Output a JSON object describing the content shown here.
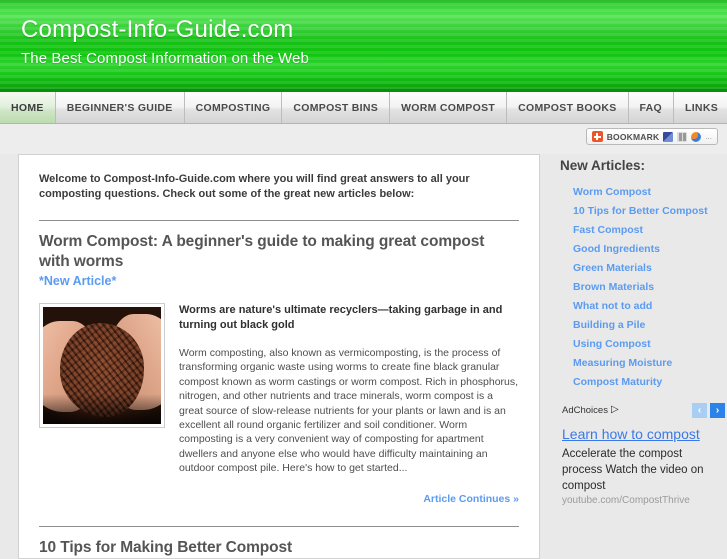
{
  "header": {
    "site_title": "Compost-Info-Guide.com",
    "tagline": "The Best Compost Information on the Web"
  },
  "nav": {
    "items": [
      {
        "label": "HOME",
        "active": true
      },
      {
        "label": "BEGINNER'S GUIDE",
        "active": false
      },
      {
        "label": "COMPOSTING",
        "active": false
      },
      {
        "label": "COMPOST BINS",
        "active": false
      },
      {
        "label": "WORM COMPOST",
        "active": false
      },
      {
        "label": "COMPOST BOOKS",
        "active": false
      },
      {
        "label": "FAQ",
        "active": false
      },
      {
        "label": "LINKS",
        "active": false
      }
    ]
  },
  "bookmark": {
    "label": "BOOKMARK",
    "plus_icon": "plus-icon",
    "icons": [
      "share-square-icon",
      "facebook-icon",
      "share-globe-icon"
    ],
    "more": "..."
  },
  "main": {
    "welcome": "Welcome to Compost-Info-Guide.com where you will find great answers to all your composting questions. Check out some of the great new articles below:",
    "articles": [
      {
        "title": "Worm Compost: A beginner's guide to making great compost with worms",
        "new_flag": "*New Article*",
        "thumb_alt": "hands-holding-worms-image",
        "subhead": "Worms are nature's ultimate recyclers—taking garbage in and turning out black gold",
        "body": "Worm composting, also known as vermicomposting, is the process of transforming organic waste using worms to create fine black granular compost known as worm castings or worm compost. Rich in phosphorus, nitrogen, and other nutrients and trace minerals, worm compost is a great source of slow-release nutrients for your plants or lawn and is an excellent all round organic fertilizer and soil conditioner. Worm composting is a very convenient way of composting for apartment dwellers and anyone else who would have difficulty maintaining an outdoor compost pile. Here's how to get started...",
        "continues_label": "Article Continues »"
      },
      {
        "title": "10 Tips for Making Better Compost"
      }
    ]
  },
  "sidebar": {
    "heading": "New Articles:",
    "links": [
      "Worm Compost",
      "10 Tips for Better Compost",
      "Fast Compost",
      "Good Ingredients",
      "Green Materials",
      "Brown Materials",
      "What not to add",
      "Building a Pile",
      "Using Compost",
      "Measuring Moisture",
      "Compost Maturity"
    ]
  },
  "ad": {
    "adchoices_label": "AdChoices",
    "adchoices_icon": "▷",
    "prev_arrow": "‹",
    "next_arrow": "›",
    "title": "Learn how to compost",
    "description": "Accelerate the compost process Watch the video on compost",
    "url": "youtube.com/CompostThrive"
  },
  "colors": {
    "banner_green": "#19c119",
    "link_blue": "#5b9bf0",
    "ad_link_blue": "#3b78e8",
    "page_gray": "#e9e9e9"
  }
}
